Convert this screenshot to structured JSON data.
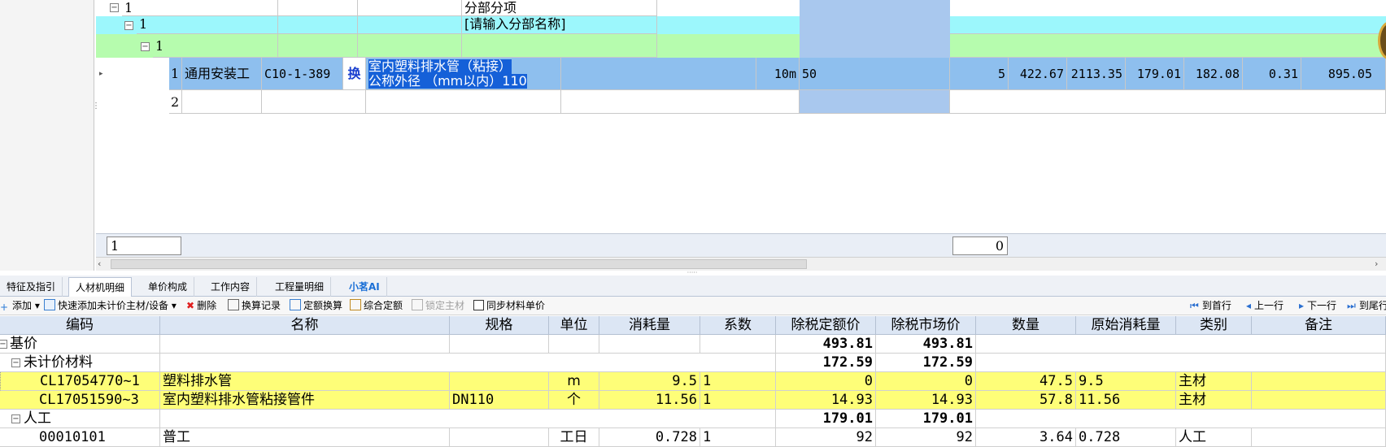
{
  "upper_grid": {
    "rows": [
      {
        "index": "1",
        "name": "分部分项"
      },
      {
        "index": "1",
        "name": "[请输入分部名称]"
      },
      {
        "index": "1"
      },
      {
        "index": "1",
        "category": "通用安装工",
        "code": "C10-1-389",
        "conversion_marker": "换",
        "name_line1": "室内塑料排水管（粘接）",
        "name_line2": "公称外径 （mm以内）110",
        "unit": "10m",
        "expr": "50",
        "quantity": "5",
        "unit_price": "422.67",
        "total_price": "2113.35",
        "labor": "179.01",
        "material": "182.08",
        "machine": "0.31",
        "labor_total": "895.05"
      },
      {
        "index": "2"
      }
    ],
    "status_left": "1",
    "status_right": "0"
  },
  "tabs": [
    {
      "label": "特征及指引"
    },
    {
      "label": "人材机明细"
    },
    {
      "label": "单价构成"
    },
    {
      "label": "工作内容"
    },
    {
      "label": "工程量明细"
    },
    {
      "label": "小茗AI"
    }
  ],
  "toolbar": {
    "add": "添加",
    "quick_add": "快速添加未计价主材/设备",
    "delete": "删除",
    "conversion_log": "换算记录",
    "quota_conversion": "定额换算",
    "composite_quota": "综合定额",
    "lock_material": "锁定主材",
    "sync_price": "同步材料单价",
    "first_row": "到首行",
    "prev_row": "上一行",
    "next_row": "下一行",
    "last_row": "到尾行"
  },
  "lower_grid": {
    "headers": [
      "编码",
      "名称",
      "规格",
      "单位",
      "消耗量",
      "系数",
      "除税定额价",
      "除税市场价",
      "数量",
      "原始消耗量",
      "类别",
      "备注"
    ],
    "rows": [
      {
        "code": "基价",
        "quota_price": "493.81",
        "market_price": "493.81"
      },
      {
        "code": "未计价材料",
        "quota_price": "172.59",
        "market_price": "172.59"
      },
      {
        "code": "CL17054770~1",
        "name": "塑料排水管",
        "spec": "",
        "unit": "m",
        "consumption": "9.5",
        "factor": "1",
        "quota_price": "0",
        "market_price": "0",
        "quantity": "47.5",
        "orig_consumption": "9.5",
        "type": "主材"
      },
      {
        "code": "CL17051590~3",
        "name": "室内塑料排水管粘接管件",
        "spec": "DN110",
        "unit": "个",
        "consumption": "11.56",
        "factor": "1",
        "quota_price": "14.93",
        "market_price": "14.93",
        "quantity": "57.8",
        "orig_consumption": "11.56",
        "type": "主材"
      },
      {
        "code": "人工",
        "quota_price": "179.01",
        "market_price": "179.01"
      },
      {
        "code": "00010101",
        "name": "普工",
        "unit": "工日",
        "consumption": "0.728",
        "factor": "1",
        "quota_price": "92",
        "market_price": "92",
        "quantity": "3.64",
        "orig_consumption": "0.728",
        "type": "人工"
      }
    ]
  },
  "colors": {
    "cyan_row": "#9cf7fc",
    "green_row": "#b6fcae",
    "selected_row": "#8ebfee",
    "highlight_row": "#fefe78",
    "header_bg": "#dce6f4"
  }
}
